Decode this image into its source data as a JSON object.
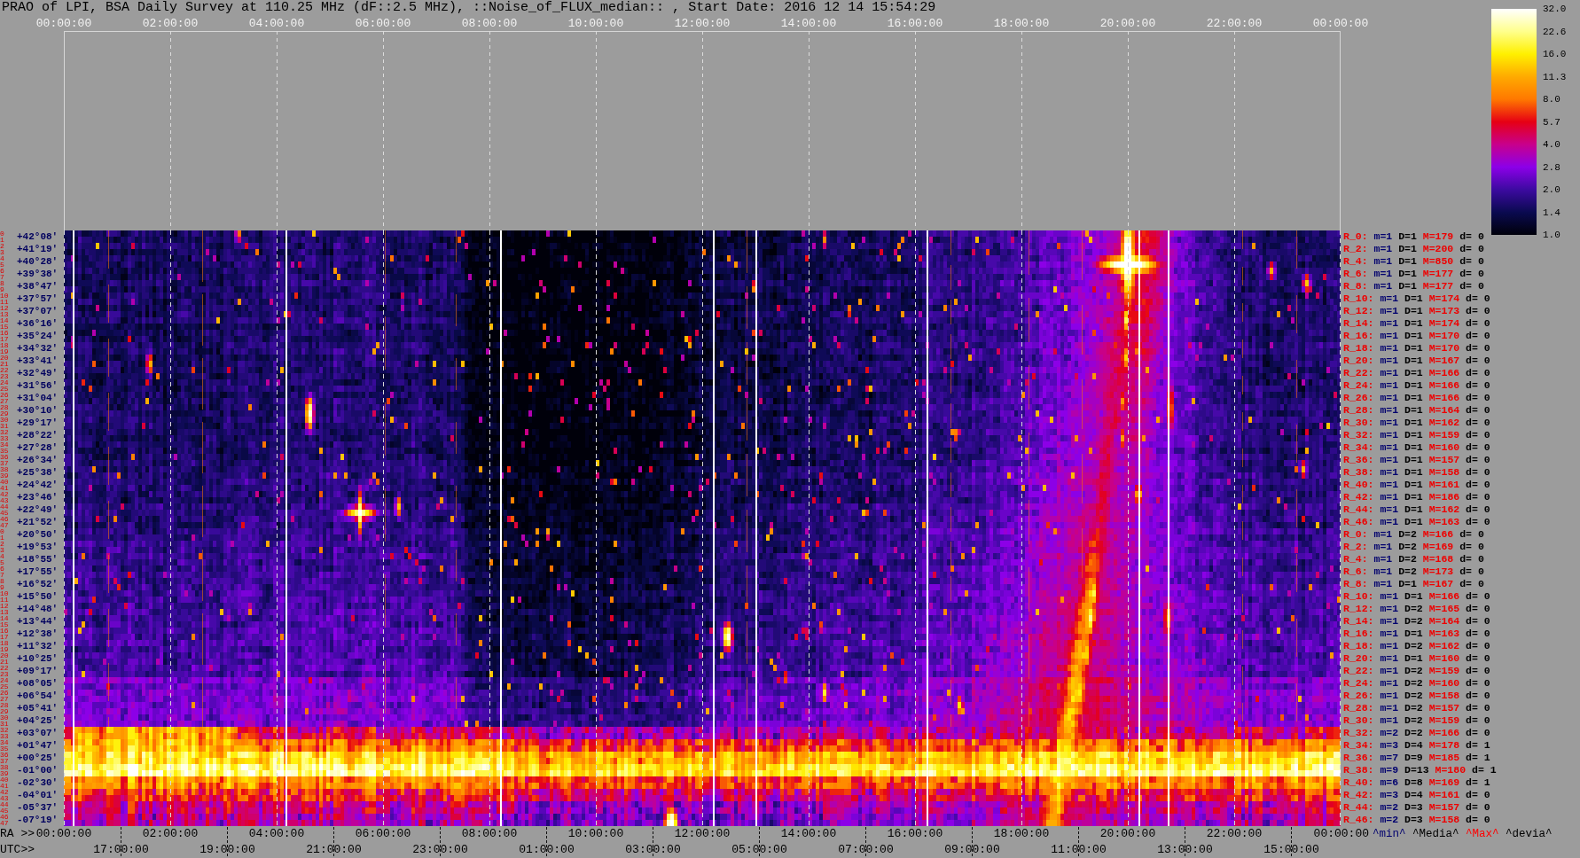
{
  "title": "PRAO of LPI, BSA Daily Survey at 110.25 MHz (dF::2.5 MHz), ::Noise_of_FLUX_median:: , Start Date: 2016 12 14 15:54:29",
  "top_axis": {
    "labels": [
      "00:00:00",
      "02:00:00",
      "04:00:00",
      "06:00:00",
      "08:00:00",
      "10:00:00",
      "12:00:00",
      "14:00:00",
      "16:00:00",
      "18:00:00",
      "20:00:00",
      "22:00:00",
      "00:00:00"
    ]
  },
  "color_scale": {
    "ticks": [
      "32.0",
      "22.6",
      "16.0",
      "11.3",
      "8.0",
      "5.7",
      "4.0",
      "2.8",
      "2.0",
      "1.4",
      "1.0"
    ]
  },
  "rows": [
    {
      "index_labels": [
        "0",
        "1"
      ],
      "declination": "+42°08'",
      "beam": "R_0:",
      "min": "m=1",
      "median": "D=1",
      "max": "M=179",
      "deviation": "d= 0"
    },
    {
      "index_labels": [
        "2",
        "3"
      ],
      "declination": "+41°19'",
      "beam": "R_2:",
      "min": "m=1",
      "median": "D=1",
      "max": "M=200",
      "deviation": "d= 0"
    },
    {
      "index_labels": [
        "4",
        "5"
      ],
      "declination": "+40°28'",
      "beam": "R_4:",
      "min": "m=1",
      "median": "D=1",
      "max": "M=850",
      "deviation": "d= 0"
    },
    {
      "index_labels": [
        "6",
        "7"
      ],
      "declination": "+39°38'",
      "beam": "R_6:",
      "min": "m=1",
      "median": "D=1",
      "max": "M=177",
      "deviation": "d= 0"
    },
    {
      "index_labels": [
        "8",
        "9"
      ],
      "declination": "+38°47'",
      "beam": "R_8:",
      "min": "m=1",
      "median": "D=1",
      "max": "M=177",
      "deviation": "d= 0"
    },
    {
      "index_labels": [
        "10",
        "11"
      ],
      "declination": "+37°57'",
      "beam": "R_10:",
      "min": "m=1",
      "median": "D=1",
      "max": "M=174",
      "deviation": "d= 0"
    },
    {
      "index_labels": [
        "12",
        "13"
      ],
      "declination": "+37°07'",
      "beam": "R_12:",
      "min": "m=1",
      "median": "D=1",
      "max": "M=173",
      "deviation": "d= 0"
    },
    {
      "index_labels": [
        "14",
        "15"
      ],
      "declination": "+36°16'",
      "beam": "R_14:",
      "min": "m=1",
      "median": "D=1",
      "max": "M=174",
      "deviation": "d= 0"
    },
    {
      "index_labels": [
        "16",
        "17"
      ],
      "declination": "+35°24'",
      "beam": "R_16:",
      "min": "m=1",
      "median": "D=1",
      "max": "M=170",
      "deviation": "d= 0"
    },
    {
      "index_labels": [
        "18",
        "19"
      ],
      "declination": "+34°32'",
      "beam": "R_18:",
      "min": "m=1",
      "median": "D=1",
      "max": "M=170",
      "deviation": "d= 0"
    },
    {
      "index_labels": [
        "20",
        "21"
      ],
      "declination": "+33°41'",
      "beam": "R_20:",
      "min": "m=1",
      "median": "D=1",
      "max": "M=167",
      "deviation": "d= 0"
    },
    {
      "index_labels": [
        "22",
        "23"
      ],
      "declination": "+32°49'",
      "beam": "R_22:",
      "min": "m=1",
      "median": "D=1",
      "max": "M=166",
      "deviation": "d= 0"
    },
    {
      "index_labels": [
        "24",
        "25"
      ],
      "declination": "+31°56'",
      "beam": "R_24:",
      "min": "m=1",
      "median": "D=1",
      "max": "M=166",
      "deviation": "d= 0"
    },
    {
      "index_labels": [
        "26",
        "27"
      ],
      "declination": "+31°04'",
      "beam": "R_26:",
      "min": "m=1",
      "median": "D=1",
      "max": "M=166",
      "deviation": "d= 0"
    },
    {
      "index_labels": [
        "28",
        "29"
      ],
      "declination": "+30°10'",
      "beam": "R_28:",
      "min": "m=1",
      "median": "D=1",
      "max": "M=164",
      "deviation": "d= 0"
    },
    {
      "index_labels": [
        "30",
        "31"
      ],
      "declination": "+29°17'",
      "beam": "R_30:",
      "min": "m=1",
      "median": "D=1",
      "max": "M=162",
      "deviation": "d= 0"
    },
    {
      "index_labels": [
        "32",
        "33"
      ],
      "declination": "+28°22'",
      "beam": "R_32:",
      "min": "m=1",
      "median": "D=1",
      "max": "M=159",
      "deviation": "d= 0"
    },
    {
      "index_labels": [
        "34",
        "35"
      ],
      "declination": "+27°28'",
      "beam": "R_34:",
      "min": "m=1",
      "median": "D=1",
      "max": "M=160",
      "deviation": "d= 0"
    },
    {
      "index_labels": [
        "36",
        "37"
      ],
      "declination": "+26°34'",
      "beam": "R_36:",
      "min": "m=1",
      "median": "D=1",
      "max": "M=157",
      "deviation": "d= 0"
    },
    {
      "index_labels": [
        "38",
        "39"
      ],
      "declination": "+25°38'",
      "beam": "R_38:",
      "min": "m=1",
      "median": "D=1",
      "max": "M=158",
      "deviation": "d= 0"
    },
    {
      "index_labels": [
        "40",
        "41"
      ],
      "declination": "+24°42'",
      "beam": "R_40:",
      "min": "m=1",
      "median": "D=1",
      "max": "M=161",
      "deviation": "d= 0"
    },
    {
      "index_labels": [
        "42",
        "43"
      ],
      "declination": "+23°46'",
      "beam": "R_42:",
      "min": "m=1",
      "median": "D=1",
      "max": "M=186",
      "deviation": "d= 0"
    },
    {
      "index_labels": [
        "44",
        "45"
      ],
      "declination": "+22°49'",
      "beam": "R_44:",
      "min": "m=1",
      "median": "D=1",
      "max": "M=162",
      "deviation": "d= 0"
    },
    {
      "index_labels": [
        "46",
        "47"
      ],
      "declination": "+21°52'",
      "beam": "R_46:",
      "min": "m=1",
      "median": "D=1",
      "max": "M=163",
      "deviation": "d= 0"
    },
    {
      "index_labels": [
        "0",
        "1"
      ],
      "declination": "+20°50'",
      "beam": "R_0:",
      "min": "m=1",
      "median": "D=2",
      "max": "M=166",
      "deviation": "d= 0"
    },
    {
      "index_labels": [
        "2",
        "3"
      ],
      "declination": "+19°53'",
      "beam": "R_2:",
      "min": "m=1",
      "median": "D=2",
      "max": "M=169",
      "deviation": "d= 0"
    },
    {
      "index_labels": [
        "4",
        "5"
      ],
      "declination": "+18°55'",
      "beam": "R_4:",
      "min": "m=1",
      "median": "D=2",
      "max": "M=168",
      "deviation": "d= 0"
    },
    {
      "index_labels": [
        "6",
        "7"
      ],
      "declination": "+17°55'",
      "beam": "R_6:",
      "min": "m=1",
      "median": "D=2",
      "max": "M=173",
      "deviation": "d= 0"
    },
    {
      "index_labels": [
        "8",
        "9"
      ],
      "declination": "+16°52'",
      "beam": "R_8:",
      "min": "m=1",
      "median": "D=1",
      "max": "M=167",
      "deviation": "d= 0"
    },
    {
      "index_labels": [
        "10",
        "11"
      ],
      "declination": "+15°50'",
      "beam": "R_10:",
      "min": "m=1",
      "median": "D=1",
      "max": "M=166",
      "deviation": "d= 0"
    },
    {
      "index_labels": [
        "12",
        "13"
      ],
      "declination": "+14°48'",
      "beam": "R_12:",
      "min": "m=1",
      "median": "D=2",
      "max": "M=165",
      "deviation": "d= 0"
    },
    {
      "index_labels": [
        "14",
        "15"
      ],
      "declination": "+13°44'",
      "beam": "R_14:",
      "min": "m=1",
      "median": "D=2",
      "max": "M=164",
      "deviation": "d= 0"
    },
    {
      "index_labels": [
        "16",
        "17"
      ],
      "declination": "+12°38'",
      "beam": "R_16:",
      "min": "m=1",
      "median": "D=1",
      "max": "M=163",
      "deviation": "d= 0"
    },
    {
      "index_labels": [
        "18",
        "19"
      ],
      "declination": "+11°32'",
      "beam": "R_18:",
      "min": "m=1",
      "median": "D=2",
      "max": "M=162",
      "deviation": "d= 0"
    },
    {
      "index_labels": [
        "20",
        "21"
      ],
      "declination": "+10°25'",
      "beam": "R_20:",
      "min": "m=1",
      "median": "D=1",
      "max": "M=160",
      "deviation": "d= 0"
    },
    {
      "index_labels": [
        "22",
        "23"
      ],
      "declination": "+09°17'",
      "beam": "R_22:",
      "min": "m=1",
      "median": "D=2",
      "max": "M=159",
      "deviation": "d= 0"
    },
    {
      "index_labels": [
        "24",
        "25"
      ],
      "declination": "+08°05'",
      "beam": "R_24:",
      "min": "m=1",
      "median": "D=2",
      "max": "M=160",
      "deviation": "d= 0"
    },
    {
      "index_labels": [
        "26",
        "27"
      ],
      "declination": "+06°54'",
      "beam": "R_26:",
      "min": "m=1",
      "median": "D=2",
      "max": "M=158",
      "deviation": "d= 0"
    },
    {
      "index_labels": [
        "28",
        "29"
      ],
      "declination": "+05°41'",
      "beam": "R_28:",
      "min": "m=1",
      "median": "D=2",
      "max": "M=157",
      "deviation": "d= 0"
    },
    {
      "index_labels": [
        "30",
        "31"
      ],
      "declination": "+04°25'",
      "beam": "R_30:",
      "min": "m=1",
      "median": "D=2",
      "max": "M=159",
      "deviation": "d= 0"
    },
    {
      "index_labels": [
        "32",
        "33"
      ],
      "declination": "+03°07'",
      "beam": "R_32:",
      "min": "m=2",
      "median": "D=2",
      "max": "M=166",
      "deviation": "d= 0"
    },
    {
      "index_labels": [
        "34",
        "35"
      ],
      "declination": "+01°47'",
      "beam": "R_34:",
      "min": "m=3",
      "median": "D=4",
      "max": "M=178",
      "deviation": "d= 1"
    },
    {
      "index_labels": [
        "36",
        "37"
      ],
      "declination": "+00°25'",
      "beam": "R_36:",
      "min": "m=7",
      "median": "D=9",
      "max": "M=185",
      "deviation": "d= 1"
    },
    {
      "index_labels": [
        "38",
        "39"
      ],
      "declination": "-01°00'",
      "beam": "R_38:",
      "min": "m=9",
      "median": "D=13",
      "max": "M=180",
      "deviation": "d= 1"
    },
    {
      "index_labels": [
        "40",
        "41"
      ],
      "declination": "-02°30'",
      "beam": "R_40:",
      "min": "m=6",
      "median": "D=8",
      "max": "M=169",
      "deviation": "d= 1"
    },
    {
      "index_labels": [
        "42",
        "43"
      ],
      "declination": "-04°01'",
      "beam": "R_42:",
      "min": "m=3",
      "median": "D=4",
      "max": "M=161",
      "deviation": "d= 0"
    },
    {
      "index_labels": [
        "44",
        "45"
      ],
      "declination": "-05°37'",
      "beam": "R_44:",
      "min": "m=2",
      "median": "D=3",
      "max": "M=157",
      "deviation": "d= 0"
    },
    {
      "index_labels": [
        "46",
        "47"
      ],
      "declination": "-07°19'",
      "beam": "R_46:",
      "min": "m=2",
      "median": "D=3",
      "max": "M=158",
      "deviation": "d= 0"
    }
  ],
  "bottom_axis": {
    "ra_prefix": "RA >>",
    "ra_labels": [
      "00:00:00",
      "02:00:00",
      "04:00:00",
      "06:00:00",
      "08:00:00",
      "10:00:00",
      "12:00:00",
      "14:00:00",
      "16:00:00",
      "18:00:00",
      "20:00:00",
      "22:00:00",
      "00:00:00"
    ],
    "legend": [
      {
        "label": "^min^",
        "color": "#00006e"
      },
      {
        "label": "^Media^",
        "color": "#000000"
      },
      {
        "label": "^Max^",
        "color": "#ff0000"
      },
      {
        "label": "^devia^",
        "color": "#000000"
      }
    ],
    "utc_prefix": "UTC>>",
    "utc_labels": [
      "17:00:00",
      "19:00:00",
      "21:00:00",
      "23:00:00",
      "01:00:00",
      "03:00:00",
      "05:00:00",
      "07:00:00",
      "09:00:00",
      "11:00:00",
      "13:00:00",
      "15:00:00"
    ]
  }
}
